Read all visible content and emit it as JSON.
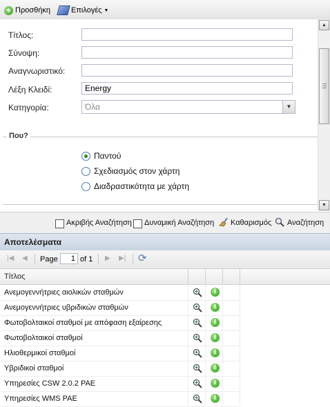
{
  "toolbar": {
    "add_label": "Προσθήκη",
    "options_label": "Επιλογές"
  },
  "form": {
    "title_label": "Τίτλος:",
    "abstract_label": "Σύνοψη:",
    "identifier_label": "Αναγνωριστικό:",
    "keyword_label": "Λέξη Κλειδί:",
    "keyword_value": "Energy",
    "category_label": "Κατηγορία:",
    "category_value": "Όλα"
  },
  "where": {
    "legend": "Που?",
    "options": [
      {
        "label": "Παντού",
        "selected": true
      },
      {
        "label": "Σχεδιασμός στον χάρτη",
        "selected": false
      },
      {
        "label": "Διαδραστικότητα με χάρτη",
        "selected": false
      }
    ]
  },
  "search_options": {
    "exact_label": "Ακριβής Αναζήτηση",
    "dynamic_label": "Δυναμική Αναζήτηση",
    "clear_label": "Καθαρισμός",
    "search_label": "Αναζήτηση"
  },
  "results": {
    "title": "Αποτελέσματα",
    "paging": {
      "page_label": "Page",
      "page_value": "1",
      "of_label": "of 1"
    },
    "column_title": "Τίτλος",
    "rows": [
      "Ανεμογεννήτριες αιολικών σταθμών",
      "Ανεμογεννήτριες υβριδικών σταθμών",
      "Φωτοβολταικοί σταθμοί με απόφαση εξαίρεσης",
      "Φωτοβολταικοί σταθμοί",
      "Ηλιοθερμικοί σταθμοί",
      "Υβριδικοί σταθμοί",
      "Υπηρεσίες CSW 2.0.2 PAE",
      "Υπηρεσίες WMS PAE"
    ]
  }
}
